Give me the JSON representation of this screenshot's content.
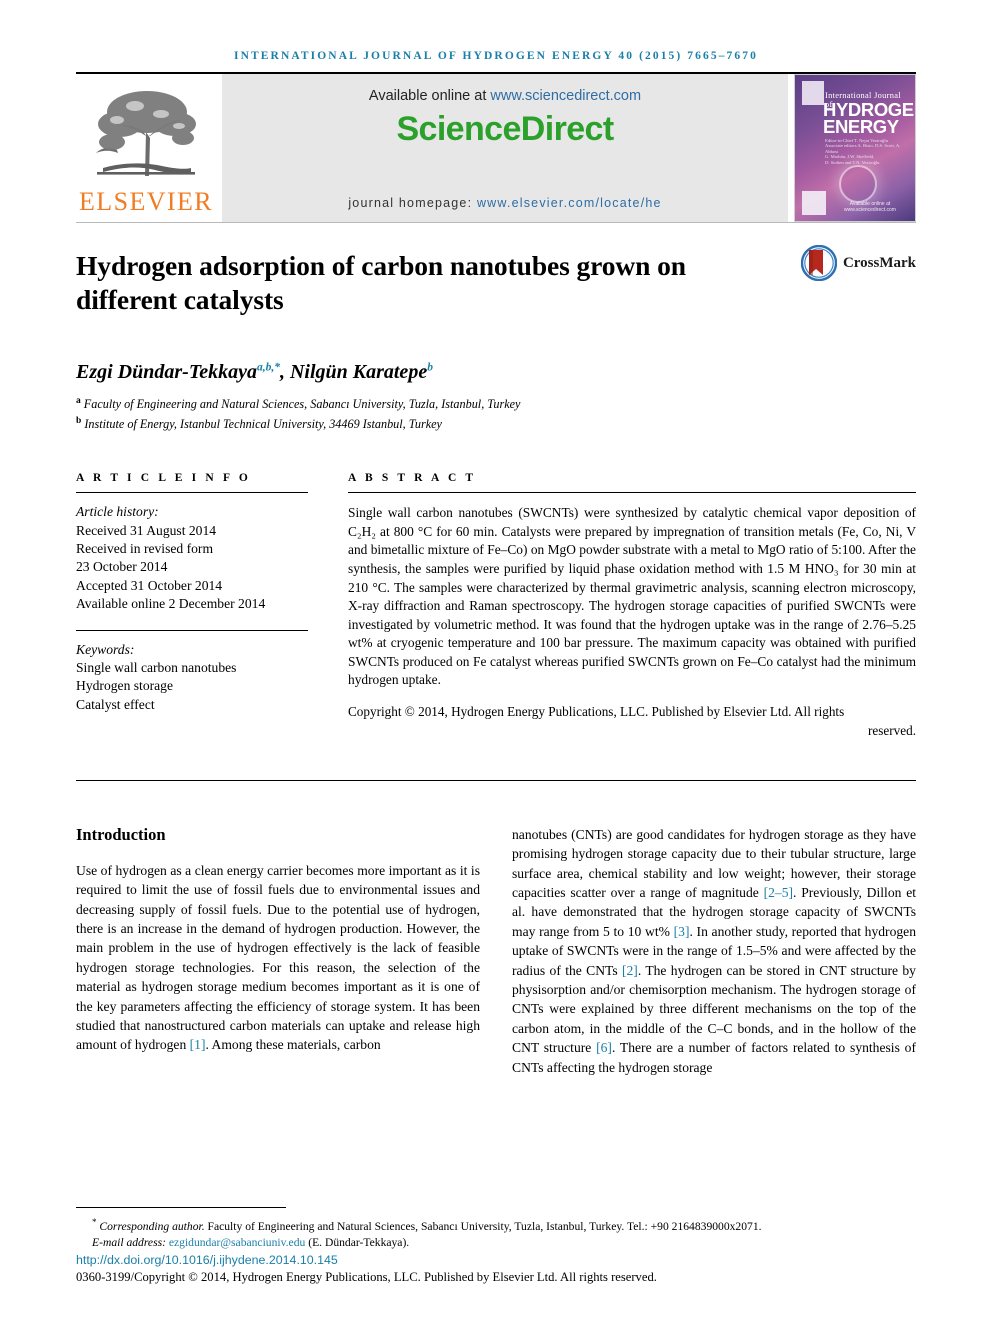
{
  "running_head": "International Journal of Hydrogen Energy 40 (2015) 7665–7670",
  "masthead": {
    "publisher_name": "ELSEVIER",
    "available_prefix": "Available online at ",
    "available_url": "www.sciencedirect.com",
    "sciencedirect_word": "ScienceDirect",
    "homepage_label": "journal homepage: ",
    "homepage_url": "www.elsevier.com/locate/he",
    "cover": {
      "line_small": "International Journal of",
      "line_big_1": "HYDROGEN",
      "line_big_2": "ENERGY",
      "editors": "Editor-in-Chief   T. Nejat Veziroğlu\nAssociate editors   A. Bisio, D.S. Scott, A. Abbasi\nG. Marbán, J.W. Sheffield,\nD. Stolten and T.N. Veziroğlu",
      "footer": "Available online at www.sciencedirect.com"
    }
  },
  "article": {
    "title": "Hydrogen adsorption of carbon nanotubes grown on different catalysts",
    "crossmark_label": "CrossMark",
    "authors": "Ezgi Dündar-Tekkaya",
    "authors_sup_1": "a,b,*",
    "authors_2": ", Nilgün Karatepe",
    "authors_sup_2": "b",
    "affiliation_a_mark": "a",
    "affiliation_a": "Faculty of Engineering and Natural Sciences, Sabancı University, Tuzla, Istanbul, Turkey",
    "affiliation_b_mark": "b",
    "affiliation_b": "Institute of Energy, Istanbul Technical University, 34469 Istanbul, Turkey"
  },
  "article_info": {
    "heading": "A R T I C L E   I N F O",
    "history_label": "Article history:",
    "history": [
      "Received 31 August 2014",
      "Received in revised form",
      "23 October 2014",
      "Accepted 31 October 2014",
      "Available online 2 December 2014"
    ],
    "keywords_label": "Keywords:",
    "keywords": [
      "Single wall carbon nanotubes",
      "Hydrogen storage",
      "Catalyst effect"
    ]
  },
  "abstract": {
    "heading": "A B S T R A C T",
    "text": "Single wall carbon nanotubes (SWCNTs) were synthesized by catalytic chemical vapor deposition of C₂H₂ at 800 °C for 60 min. Catalysts were prepared by impregnation of transition metals (Fe, Co, Ni, V and bimetallic mixture of Fe–Co) on MgO powder substrate with a metal to MgO ratio of 5:100. After the synthesis, the samples were purified by liquid phase oxidation method with 1.5 M HNO₃ for 30 min at 210 °C. The samples were characterized by thermal gravimetric analysis, scanning electron microscopy, X-ray diffraction and Raman spectroscopy. The hydrogen storage capacities of purified SWCNTs were investigated by volumetric method. It was found that the hydrogen uptake was in the range of 2.76–5.25 wt% at cryogenic temperature and 100 bar pressure. The maximum capacity was obtained with purified SWCNTs produced on Fe catalyst whereas purified SWCNTs grown on Fe–Co catalyst had the minimum hydrogen uptake.",
    "copyright": "Copyright © 2014, Hydrogen Energy Publications, LLC. Published by Elsevier Ltd. All rights",
    "copyright_tail": "reserved."
  },
  "body": {
    "section_title": "Introduction",
    "col_left": "Use of hydrogen as a clean energy carrier becomes more important as it is required to limit the use of fossil fuels due to environmental issues and decreasing supply of fossil fuels. Due to the potential use of hydrogen, there is an increase in the demand of hydrogen production. However, the main problem in the use of hydrogen effectively is the lack of feasible hydrogen storage technologies. For this reason, the selection of the material as hydrogen storage medium becomes important as it is one of the key parameters affecting the efficiency of storage system. It has been studied that nanostructured carbon materials can uptake and release high amount of hydrogen ",
    "col_left_ref": "[1]",
    "col_left_tail": ". Among these materials, carbon",
    "col_right_1": "nanotubes (CNTs) are good candidates for hydrogen storage as they have promising hydrogen storage capacity due to their tubular structure, large surface area, chemical stability and low weight; however, their storage capacities scatter over a range of magnitude ",
    "col_right_ref_1": "[2–5]",
    "col_right_2": ". Previously, Dillon et al. have demonstrated that the hydrogen storage capacity of SWCNTs may range from 5 to 10 wt% ",
    "col_right_ref_2": "[3]",
    "col_right_3": ". In another study, reported that hydrogen uptake of SWCNTs were in the range of 1.5–5% and were affected by the radius of the CNTs ",
    "col_right_ref_3": "[2]",
    "col_right_4": ". The hydrogen can be stored in CNT structure by physisorption and/or chemisorption mechanism. The hydrogen storage of CNTs were explained by three different mechanisms on the top of the carbon atom, in the middle of the C–C bonds, and in the hollow of the CNT structure ",
    "col_right_ref_4": "[6]",
    "col_right_5": ". There are a number of factors related to synthesis of CNTs affecting the hydrogen storage"
  },
  "footer": {
    "corresponding_star": "*",
    "corresponding_label": "Corresponding author.",
    "corresponding_text": " Faculty of Engineering and Natural Sciences, Sabancı University, Tuzla, Istanbul, Turkey. Tel.: +90 2164839000x2071.",
    "email_label": "E-mail address: ",
    "email": "ezgidundar@sabanciuniv.edu",
    "email_suffix": " (E. Dündar-Tekkaya).",
    "doi": "http://dx.doi.org/10.1016/j.ijhydene.2014.10.145",
    "issn_line": "0360-3199/Copyright © 2014, Hydrogen Energy Publications, LLC. Published by Elsevier Ltd. All rights reserved."
  },
  "colors": {
    "journal_blue": "#1a7fa8",
    "elsevier_orange": "#f07c23",
    "sciencedirect_green": "#2ba02b",
    "link_blue": "#2e6da4"
  }
}
